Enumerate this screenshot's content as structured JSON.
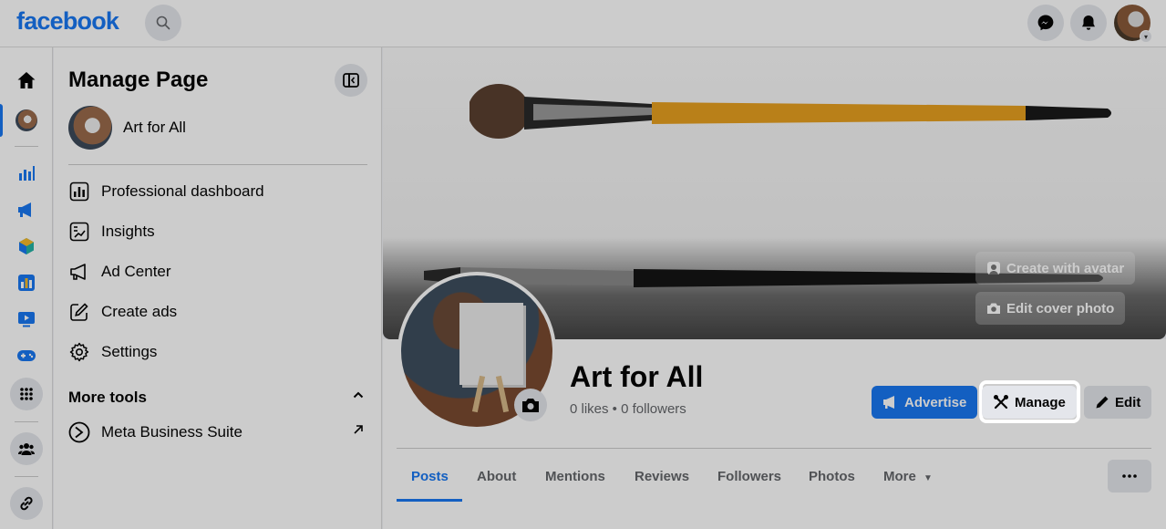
{
  "header": {
    "logo": "facebook"
  },
  "icons": {
    "search": "search-icon",
    "messenger": "messenger-icon",
    "notifications": "bell-icon",
    "home": "home-icon"
  },
  "sidebar": {
    "title": "Manage Page",
    "page_name": "Art for All",
    "items": [
      {
        "label": "Professional dashboard",
        "icon": "dashboard-icon"
      },
      {
        "label": "Insights",
        "icon": "insights-icon"
      },
      {
        "label": "Ad Center",
        "icon": "megaphone-icon"
      },
      {
        "label": "Create ads",
        "icon": "pencil-square-icon"
      },
      {
        "label": "Settings",
        "icon": "gear-icon"
      }
    ],
    "more_tools_label": "More tools",
    "more_tools_items": [
      {
        "label": "Meta Business Suite",
        "icon": "meta-business-icon"
      }
    ]
  },
  "cover": {
    "create_avatar_label": "Create with avatar",
    "edit_cover_label": "Edit cover photo"
  },
  "profile": {
    "name": "Art for All",
    "stats": "0 likes • 0 followers"
  },
  "actions": {
    "advertise_label": "Advertise",
    "manage_label": "Manage",
    "edit_label": "Edit"
  },
  "tabs": [
    {
      "label": "Posts",
      "active": true
    },
    {
      "label": "About"
    },
    {
      "label": "Mentions"
    },
    {
      "label": "Reviews"
    },
    {
      "label": "Followers"
    },
    {
      "label": "Photos"
    },
    {
      "label": "More"
    }
  ],
  "colors": {
    "brand": "#1877f2",
    "button_grey": "#e4e6eb",
    "text_secondary": "#65676b"
  }
}
